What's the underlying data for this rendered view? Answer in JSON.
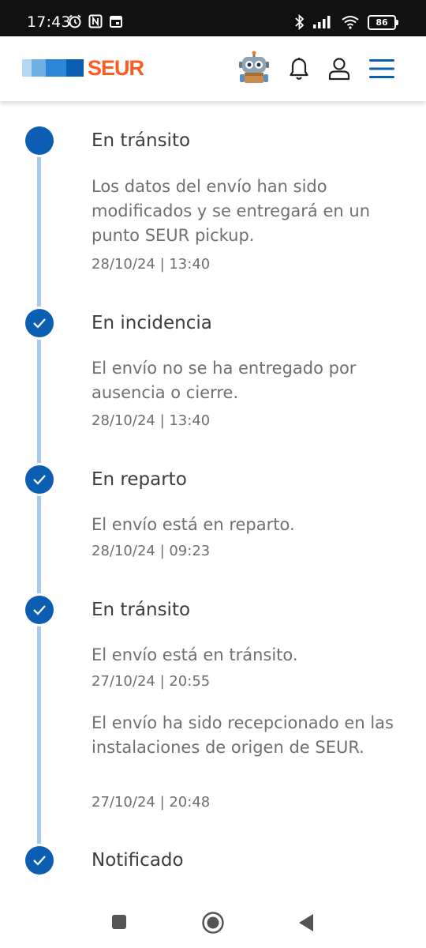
{
  "status_bar": {
    "time": "17:43",
    "battery": "86"
  },
  "header": {
    "brand": "SEUR",
    "brand_color": "#ff5a1f",
    "accent_color": "#0b5eb1",
    "icons": [
      "robot-assistant-icon",
      "bell-icon",
      "user-icon",
      "menu-icon"
    ]
  },
  "events": [
    {
      "title": "En tránsito",
      "status": "current",
      "updates": [
        {
          "description": "Los datos del envío han sido modificados y se entregará en un punto SEUR pickup.",
          "date": "28/10/24 | 13:40"
        }
      ]
    },
    {
      "title": "En incidencia",
      "status": "done",
      "updates": [
        {
          "description": "El envío no se ha entregado por ausencia o cierre.",
          "date": "28/10/24 | 13:40"
        }
      ]
    },
    {
      "title": "En reparto",
      "status": "done",
      "updates": [
        {
          "description": "El envío está en reparto.",
          "date": "28/10/24 | 09:23"
        }
      ]
    },
    {
      "title": "En tránsito",
      "status": "done",
      "updates": [
        {
          "description": "El envío está en tránsito.",
          "date": "27/10/24 | 20:55"
        },
        {
          "description": "El envío ha sido recepcionado en las instalaciones de origen de SEUR.",
          "date": "27/10/24 | 20:48"
        }
      ]
    },
    {
      "title": "Notificado",
      "status": "done",
      "updates": []
    }
  ]
}
